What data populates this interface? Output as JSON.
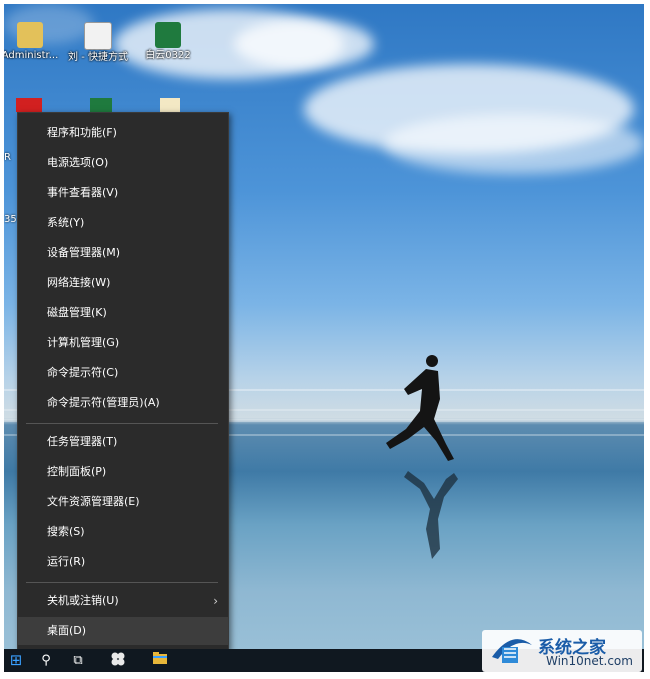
{
  "desktop": {
    "icons": [
      {
        "label": "Administr...",
        "name": "desktop-icon-administrator"
      },
      {
        "label": "刘 - 快捷方式",
        "name": "desktop-icon-shortcut"
      },
      {
        "label": "白云0322",
        "name": "desktop-icon-excel-file"
      }
    ],
    "second_row": [
      "R",
      "",
      ""
    ],
    "side_label": "35"
  },
  "context_menu": {
    "group1": [
      "程序和功能(F)",
      "电源选项(O)",
      "事件查看器(V)",
      "系统(Y)",
      "设备管理器(M)",
      "网络连接(W)",
      "磁盘管理(K)",
      "计算机管理(G)",
      "命令提示符(C)",
      "命令提示符(管理员)(A)"
    ],
    "group2": [
      "任务管理器(T)",
      "控制面板(P)",
      "文件资源管理器(E)",
      "搜索(S)",
      "运行(R)"
    ],
    "group3": [
      "关机或注销(U)",
      "桌面(D)"
    ],
    "submenu_chevron": "›"
  },
  "annotation": {
    "color": "#e8322a"
  },
  "taskbar": {
    "start_icon": "⊞",
    "search_icon": "⚲",
    "taskview_icon": "⧉"
  },
  "watermark": {
    "title": "系统之家",
    "url": "Win10net.com"
  }
}
